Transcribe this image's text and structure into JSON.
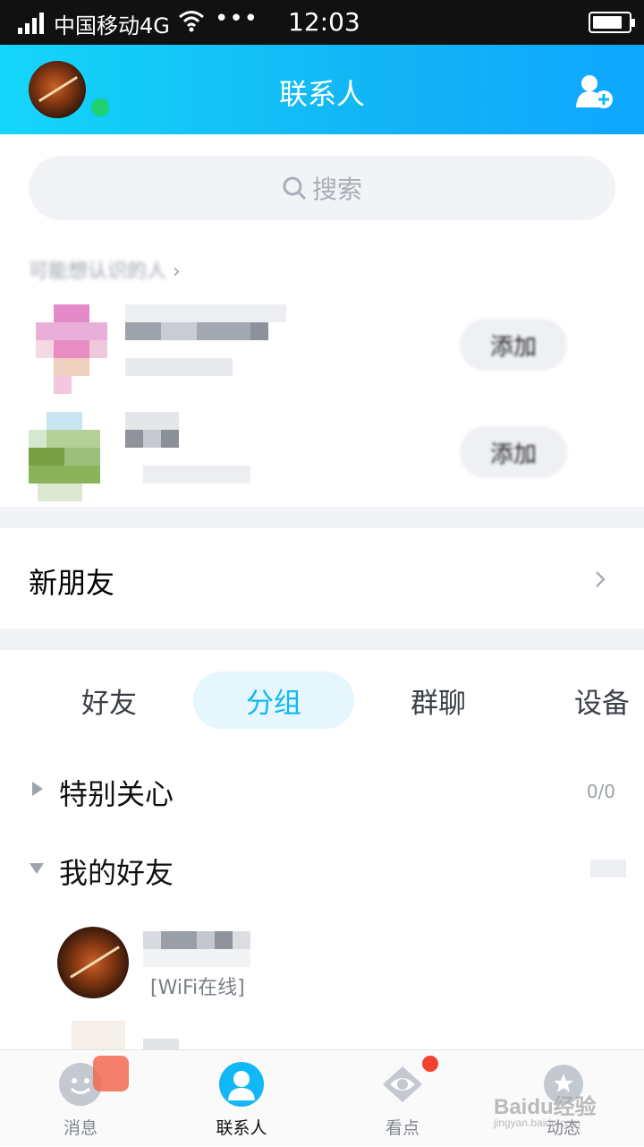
{
  "status_bar": {
    "carrier": "中国移动4G",
    "dots": "•••",
    "time": "12:03"
  },
  "header": {
    "title": "联系人"
  },
  "search": {
    "placeholder": "搜索"
  },
  "suggested": {
    "label": "可能想认识的人",
    "add_label_1": "添加",
    "add_label_2": "添加"
  },
  "new_friends": {
    "label": "新朋友"
  },
  "tabs": [
    {
      "label": "好友"
    },
    {
      "label": "分组"
    },
    {
      "label": "群聊"
    },
    {
      "label": "设备"
    }
  ],
  "groups": [
    {
      "name": "特别关心",
      "count": "0/0",
      "expanded": false
    },
    {
      "name": "我的好友",
      "count": "",
      "expanded": true
    }
  ],
  "friend": {
    "status": "[WiFi在线]"
  },
  "bottom_nav": [
    {
      "label": "消息",
      "icon": "message-icon"
    },
    {
      "label": "联系人",
      "icon": "contacts-icon"
    },
    {
      "label": "看点",
      "icon": "eye-icon"
    },
    {
      "label": "动态",
      "icon": "star-planet-icon"
    }
  ],
  "watermark": {
    "main": "Baidu经验",
    "sub": "jingyan.baidu.com"
  },
  "colors": {
    "accent": "#12b7f5",
    "online": "#1ed36e",
    "badge": "#f2412e"
  }
}
